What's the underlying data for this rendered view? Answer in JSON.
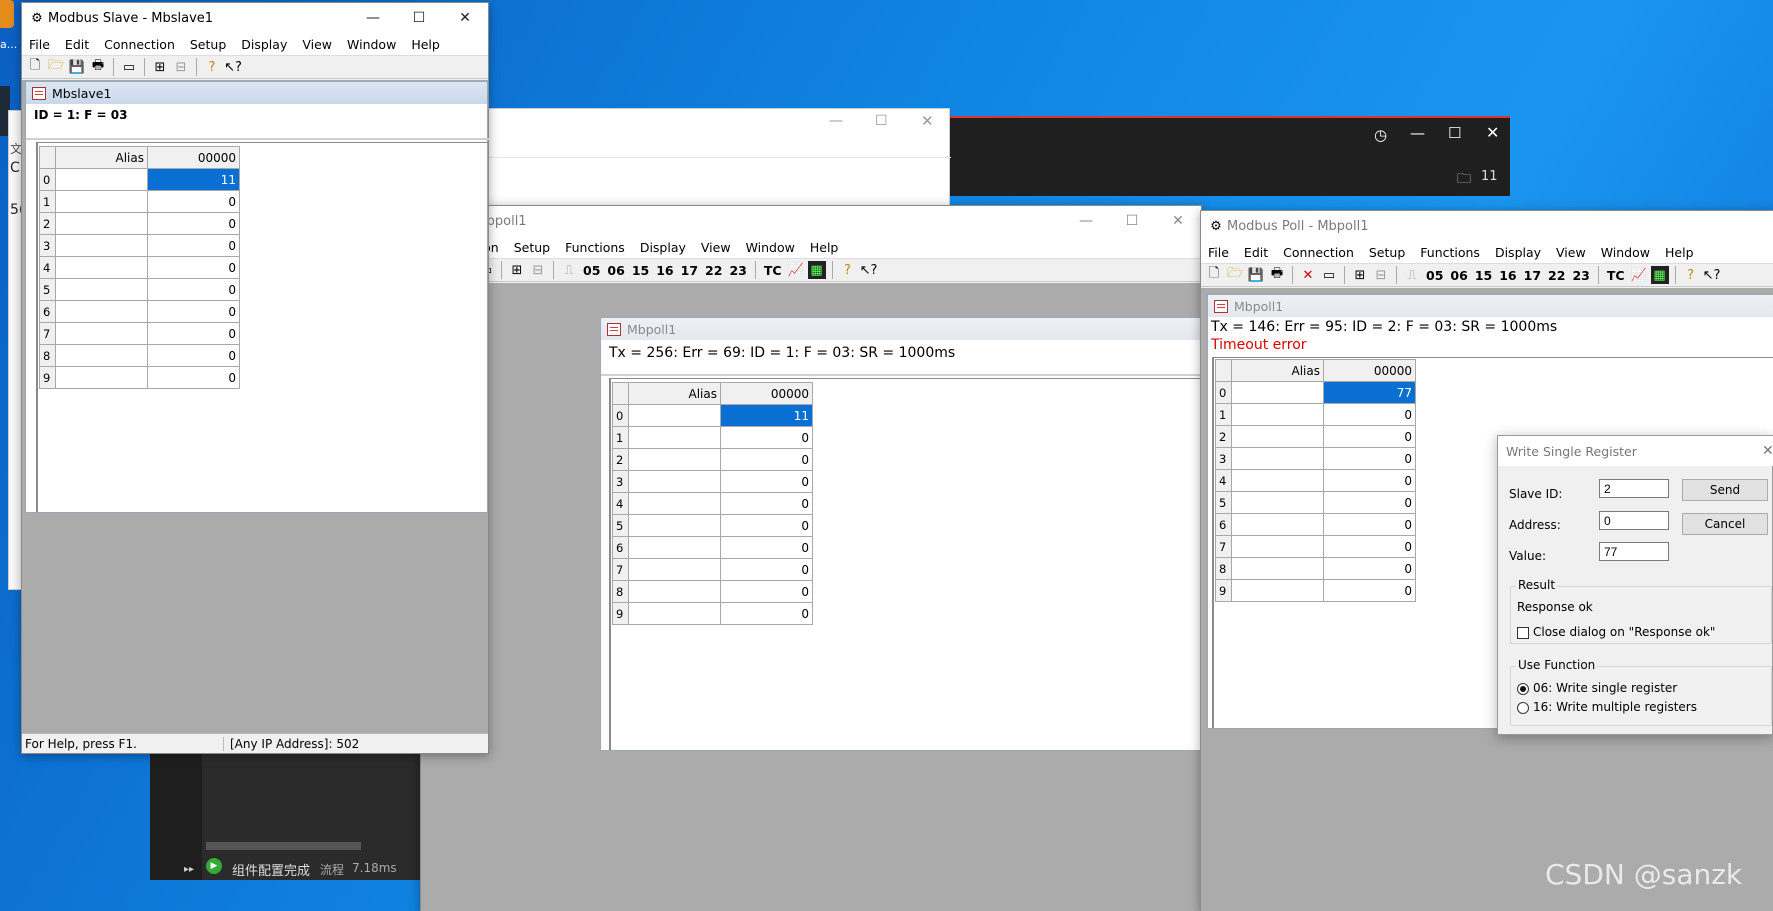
{
  "desktop": {
    "left_icon_texts": [
      "a...",
      "文",
      "C",
      "5("
    ],
    "watermark": "CSDN @sanzk",
    "taskbar_status": "组件配置完成",
    "taskbar_flow": "流程",
    "taskbar_time": "7.18ms",
    "dark_window_badge": "11"
  },
  "slave": {
    "title": "Modbus Slave - Mbslave1",
    "menu": [
      "File",
      "Edit",
      "Connection",
      "Setup",
      "Display",
      "View",
      "Window",
      "Help"
    ],
    "doc_title": "Mbslave1",
    "info": "ID = 1: F = 03",
    "grid": {
      "alias_header": "Alias",
      "col_header": "00000",
      "rows": [
        "0",
        "1",
        "2",
        "3",
        "4",
        "5",
        "6",
        "7",
        "8",
        "9"
      ],
      "values": [
        "11",
        "0",
        "0",
        "0",
        "0",
        "0",
        "0",
        "0",
        "0",
        "0"
      ]
    },
    "status_left": "For Help, press F1.",
    "status_right": "[Any IP Address]: 502"
  },
  "poll1": {
    "title": "s Poll - Mbpoll1",
    "menu": [
      "Connection",
      "Setup",
      "Functions",
      "Display",
      "View",
      "Window",
      "Help"
    ],
    "func_codes": [
      "05",
      "06",
      "15",
      "16",
      "17",
      "22",
      "23",
      "TC"
    ],
    "doc_title": "Mbpoll1",
    "info": "Tx = 256: Err = 69: ID = 1: F = 03: SR = 1000ms",
    "grid": {
      "alias_header": "Alias",
      "col_header": "00000",
      "rows": [
        "0",
        "1",
        "2",
        "3",
        "4",
        "5",
        "6",
        "7",
        "8",
        "9"
      ],
      "values": [
        "11",
        "0",
        "0",
        "0",
        "0",
        "0",
        "0",
        "0",
        "0",
        "0"
      ]
    }
  },
  "poll2": {
    "title": "Modbus Poll - Mbpoll1",
    "menu": [
      "File",
      "Edit",
      "Connection",
      "Setup",
      "Functions",
      "Display",
      "View",
      "Window",
      "Help"
    ],
    "func_codes": [
      "05",
      "06",
      "15",
      "16",
      "17",
      "22",
      "23",
      "TC"
    ],
    "doc_title": "Mbpoll1",
    "info": "Tx = 146: Err = 95: ID = 2: F = 03: SR = 1000ms",
    "error": "Timeout error",
    "grid": {
      "alias_header": "Alias",
      "col_header": "00000",
      "rows": [
        "0",
        "1",
        "2",
        "3",
        "4",
        "5",
        "6",
        "7",
        "8",
        "9"
      ],
      "values": [
        "77",
        "0",
        "0",
        "0",
        "0",
        "0",
        "0",
        "0",
        "0",
        "0"
      ]
    }
  },
  "dialog": {
    "title": "Write Single Register",
    "slave_id_label": "Slave ID:",
    "slave_id_value": "2",
    "address_label": "Address:",
    "address_value": "0",
    "value_label": "Value:",
    "value_value": "77",
    "send": "Send",
    "cancel": "Cancel",
    "result_label": "Result",
    "result_text": "Response ok",
    "close_checkbox": "Close dialog on \"Response ok\"",
    "use_function_label": "Use Function",
    "opt06": "06: Write single register",
    "opt16": "16: Write multiple registers"
  },
  "colors": {
    "selection": "#0a6fd3",
    "error": "#e00000",
    "accent": "#0078d7"
  }
}
